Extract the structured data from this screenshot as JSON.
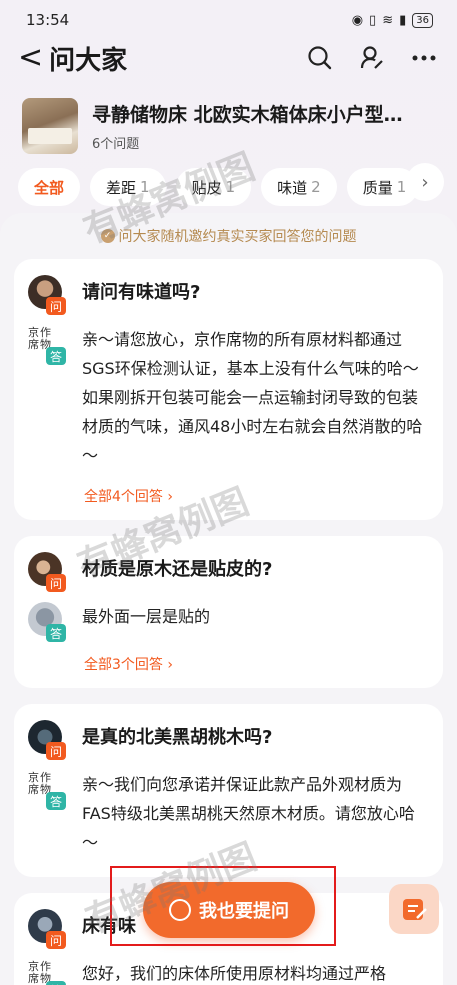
{
  "status_bar": {
    "time": "13:54",
    "battery": "36"
  },
  "nav": {
    "back_glyph": "<",
    "title": "问大家",
    "icons": [
      "search-icon",
      "user-edit-icon",
      "more-icon"
    ]
  },
  "product": {
    "title": "寻静储物床 北欧实木箱体床小户型…",
    "question_count": "6个问题"
  },
  "tabs": [
    {
      "label": "全部",
      "count": "",
      "active": true
    },
    {
      "label": "差距",
      "count": "1",
      "active": false
    },
    {
      "label": "贴皮",
      "count": "1",
      "active": false
    },
    {
      "label": "味道",
      "count": "2",
      "active": false
    },
    {
      "label": "质量",
      "count": "1",
      "active": false
    }
  ],
  "notice": "问大家随机邀约真实买家回答您的问题",
  "cards": [
    {
      "question": "请问有味道吗?",
      "answer": "亲～请您放心，京作席物的所有原材料都通过SGS环保检测认证，基本上没有什么气味的哈～如果刚拆开包装可能会一点运输封闭导致的包装材质的气味，通风48小时左右就会自然消散的哈～",
      "more": "全部4个回答 ›"
    },
    {
      "question": "材质是原木还是贴皮的?",
      "answer": "最外面一层是贴的",
      "more": "全部3个回答 ›"
    },
    {
      "question": "是真的北美黑胡桃木吗?",
      "answer": "亲～我们向您承诺并保证此款产品外观材质为FAS特级北美黑胡桃天然原木材质。请您放心哈～",
      "more": ""
    },
    {
      "question": "床有味",
      "answer": "您好，我们的床体所使用原材料均通过严格",
      "more": ""
    }
  ],
  "tag_labels": {
    "question": "问",
    "answer": "答"
  },
  "brand_avatar": "京作\n席物",
  "ask_button": "我也要提问",
  "watermark": "有蜂窝例图",
  "colors": {
    "accent": "#f25a1f",
    "answer_tag": "#2fb5a6",
    "notice": "#b58a50",
    "highlight": "#e31b1b"
  }
}
